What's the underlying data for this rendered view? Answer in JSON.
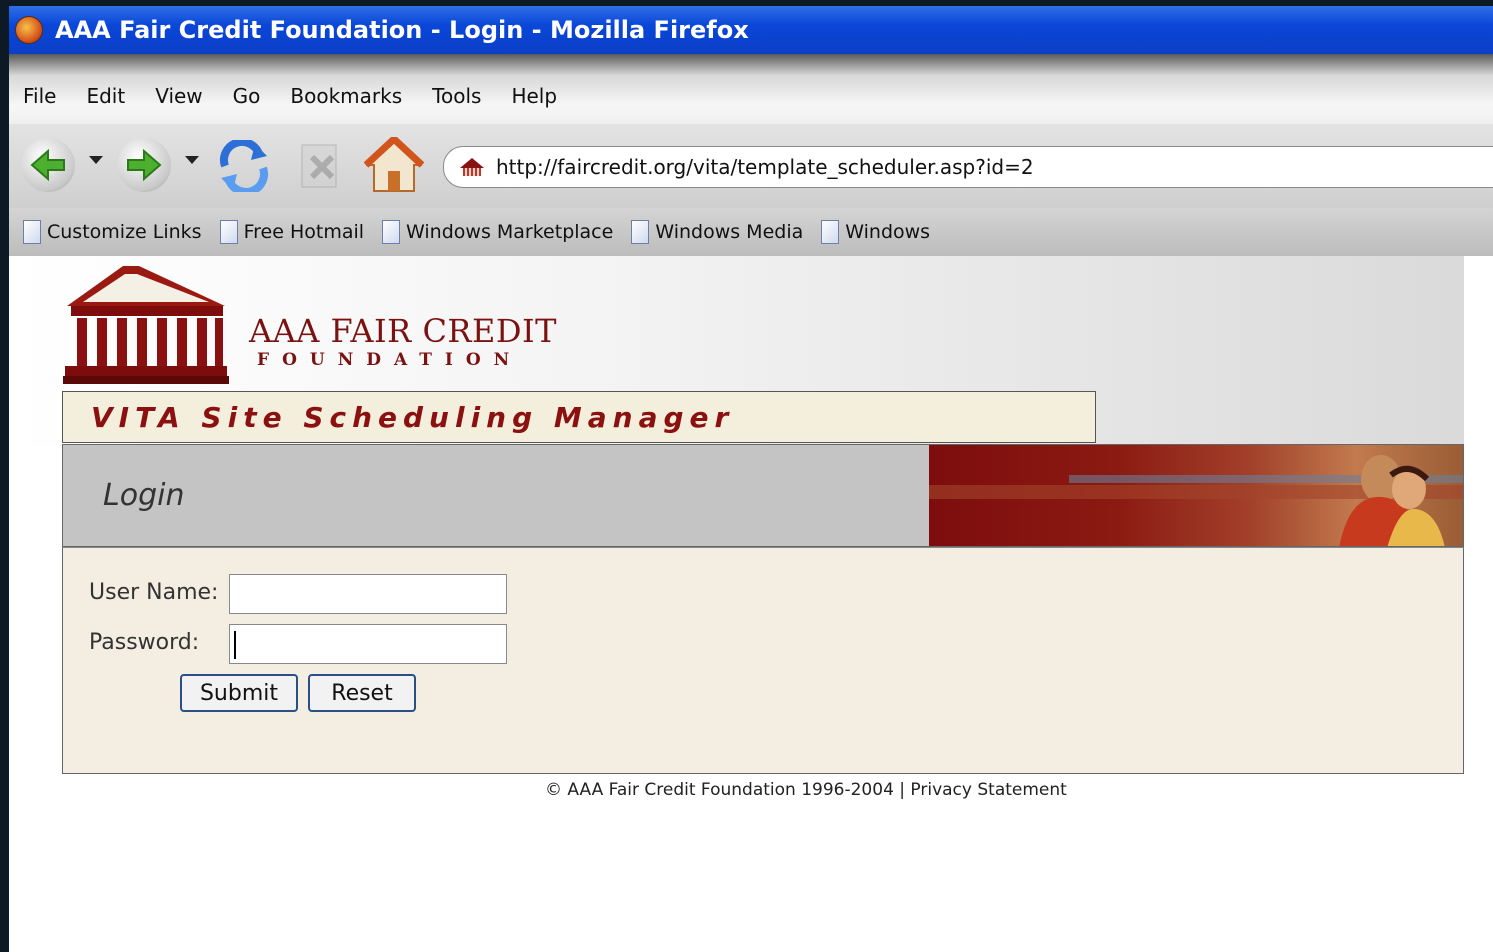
{
  "window": {
    "title": "AAA Fair Credit Foundation - Login - Mozilla Firefox"
  },
  "menu": [
    "File",
    "Edit",
    "View",
    "Go",
    "Bookmarks",
    "Tools",
    "Help"
  ],
  "toolbar": {
    "url": "http://faircredit.org/vita/template_scheduler.asp?id=2",
    "icons": [
      "back-icon",
      "forward-icon",
      "reload-icon",
      "stop-icon",
      "home-icon"
    ]
  },
  "bookmarks": [
    "Customize Links",
    "Free Hotmail",
    "Windows Marketplace",
    "Windows Media",
    "Windows"
  ],
  "site": {
    "logo_name": "AAA FAIR CREDIT",
    "logo_sub": "FOUNDATION",
    "app_title": "VITA Site Scheduling Manager",
    "section_title": "Login"
  },
  "form": {
    "username_label": "User Name:",
    "username_value": "",
    "password_label": "Password:",
    "password_value": "",
    "submit_label": "Submit",
    "reset_label": "Reset"
  },
  "footer": {
    "text": "© AAA Fair Credit Foundation 1996-2004 | Privacy Statement"
  },
  "colors": {
    "titlebar": "#0a46d8",
    "brand_red": "#8b1010",
    "panel_bg": "#f4eee2"
  }
}
